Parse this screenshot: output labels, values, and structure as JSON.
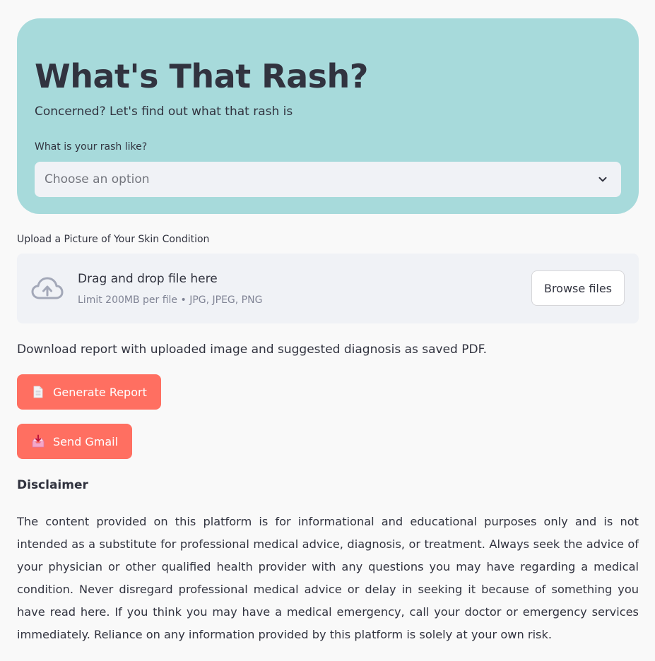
{
  "header": {
    "title": "What's That Rash?",
    "subtitle": "Concerned? Let's find out what that rash is",
    "background_color": "#a7dadb"
  },
  "rash_select": {
    "label": "What is your rash like?",
    "value": "Choose an option",
    "icon": "chevron-down-icon"
  },
  "uploader": {
    "label": "Upload a Picture of Your Skin Condition",
    "drop_title": "Drag and drop file here",
    "limit_text": "Limit 200MB per file • JPG, JPEG, PNG",
    "browse_label": "Browse files",
    "icon": "cloud-upload-icon"
  },
  "download_text": "Download report with uploaded image and suggested diagnosis as saved PDF.",
  "buttons": {
    "accent_color": "#ff6f61",
    "generate_report": {
      "label": "Generate Report",
      "icon": "page-icon"
    },
    "send_gmail": {
      "label": "Send Gmail",
      "icon": "inbox-tray-icon"
    }
  },
  "disclaimer": {
    "title": "Disclaimer",
    "body": "The content provided on this platform is for informational and educational purposes only and is not intended as a substitute for professional medical advice, diagnosis, or treatment. Always seek the advice of your physician or other qualified health provider with any questions you may have regarding a medical condition. Never disregard professional medical advice or delay in seeking it because of something you have read here. If you think you may have a medical emergency, call your doctor or emergency services immediately. Reliance on any information provided by this platform is solely at your own risk."
  }
}
